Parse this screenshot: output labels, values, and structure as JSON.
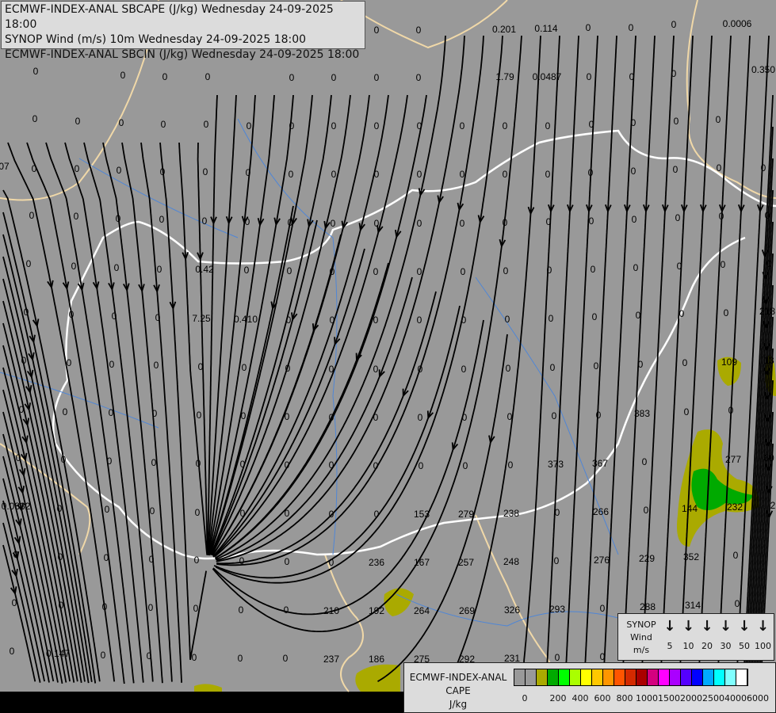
{
  "title_lines": [
    "ECMWF-INDEX-ANAL SBCAPE (J/kg) Wednesday 24-09-2025 18:00",
    "SYNOP Wind (m/s) 10m Wednesday 24-09-2025 18:00",
    "ECMWF-INDEX-ANAL SBCIN (J/kg) Wednesday 24-09-2025 18:00"
  ],
  "wind_legend": {
    "label_lines": [
      "SYNOP",
      "Wind",
      "m/s"
    ],
    "speeds": [
      "5",
      "10",
      "20",
      "30",
      "50",
      "100"
    ],
    "arrow_icon": "↓"
  },
  "cape_legend": {
    "label_lines": [
      "ECMWF-INDEX-ANAL",
      "CAPE",
      "J/kg"
    ],
    "colors": [
      "#999999",
      "#999999",
      "#aaaa00",
      "#00aa00",
      "#00ff00",
      "#aaff00",
      "#ffff00",
      "#ffc800",
      "#ff9600",
      "#ff5500",
      "#d42a00",
      "#aa0000",
      "#d4007f",
      "#ff00ff",
      "#aa00ff",
      "#5500ff",
      "#0000ff",
      "#00aaff",
      "#00ffff",
      "#80ffff",
      "#ffffff"
    ],
    "ticks": [
      "0",
      "200",
      "400",
      "600",
      "800",
      "1000",
      "1500",
      "2000",
      "2500",
      "4000",
      "6000"
    ]
  },
  "cape_values": [
    "0",
    "0",
    "0",
    "0",
    "0",
    "0",
    "0",
    "0",
    "0",
    "0",
    "0.201",
    "0.114",
    "0",
    "0",
    "0",
    "0.0006",
    "1.79",
    "0.0487",
    "0",
    "0",
    "0",
    "0.350",
    "0",
    "0",
    "0",
    "0",
    "0",
    "0",
    "0",
    "0",
    "0",
    "0",
    "0",
    "0",
    "0",
    "0",
    "0",
    "0",
    "0",
    "07",
    "0",
    "0",
    "0",
    "0",
    "0",
    "0",
    "0",
    "0",
    "0",
    "0",
    "0",
    "0",
    "0",
    "0",
    "0",
    "0",
    "0",
    "0",
    "0",
    "0",
    "0",
    "0",
    "0",
    "0",
    "0",
    "0",
    "0",
    "0",
    "0",
    "0",
    "0",
    "0",
    "0",
    "0",
    "0",
    "0",
    "0",
    "0",
    "0",
    "0",
    "0.42",
    "0",
    "0",
    "0",
    "0",
    "0",
    "0",
    "0",
    "0",
    "0",
    "0",
    "0",
    "0",
    "0",
    "0",
    "0",
    "0",
    "0",
    "7.25",
    "0.410",
    "0",
    "0",
    "0",
    "0",
    "0",
    "0",
    "0",
    "0",
    "0",
    "0",
    "0",
    "218",
    "0",
    "0",
    "0",
    "0",
    "0",
    "0",
    "0",
    "0",
    "0",
    "0",
    "0",
    "0",
    "0",
    "0",
    "0",
    "0",
    "109",
    "13",
    "0",
    "0",
    "0",
    "0",
    "0",
    "0",
    "0",
    "0",
    "0",
    "0",
    "0",
    "0",
    "0",
    "0",
    "383",
    "0",
    "0",
    "0",
    "0",
    "0",
    "0",
    "0",
    "0",
    "0",
    "0",
    "0",
    "0",
    "0",
    "0",
    "373",
    "367",
    "0",
    "277",
    "60",
    "0.0832",
    "0",
    "0",
    "0",
    "0",
    "0",
    "0",
    "0",
    "0",
    "153",
    "279",
    "238",
    "0",
    "266",
    "0",
    "144",
    "232",
    "2",
    "0",
    "0",
    "0",
    "0",
    "0",
    "0",
    "0",
    "0",
    "236",
    "167",
    "257",
    "248",
    "0",
    "276",
    "229",
    "352",
    "0",
    "0",
    "0",
    "0",
    "0",
    "0",
    "0",
    "0",
    "210",
    "192",
    "264",
    "269",
    "326",
    "293",
    "0",
    "288",
    "314",
    "0",
    "0",
    "0.147",
    "0",
    "0",
    "0",
    "0",
    "0",
    "237",
    "186",
    "275",
    "292",
    "231",
    "0",
    "0"
  ]
}
